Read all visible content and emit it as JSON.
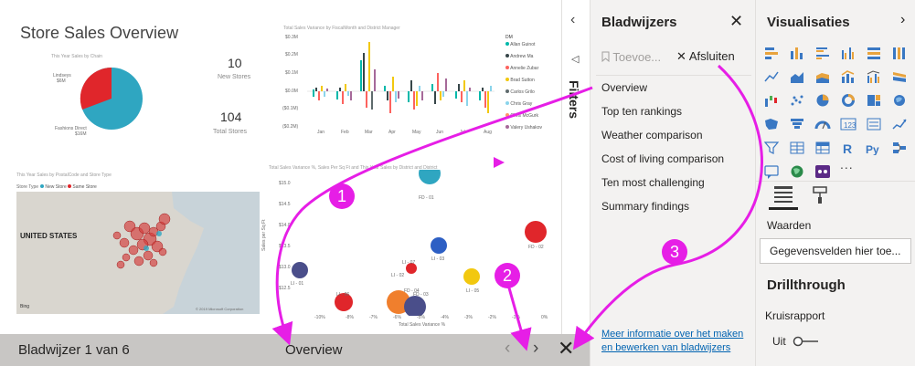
{
  "report": {
    "title": "Store Sales Overview",
    "pie": {
      "title": "This Year Sales by Chain",
      "slices": [
        {
          "label": "Lindseys",
          "value_label": "$6M",
          "share": 0.3,
          "color": "#e0262b"
        },
        {
          "label": "Fashions Direct",
          "value_label": "$16M",
          "share": 0.7,
          "color": "#2fa6c1"
        }
      ]
    },
    "kpis": [
      {
        "value": "10",
        "label": "New Stores"
      },
      {
        "value": "104",
        "label": "Total Stores"
      }
    ],
    "variance_chart": {
      "title": "Total Sales Variance by FiscalMonth and District Manager",
      "y_ticks": [
        "$0.3M",
        "$0.2M",
        "$0.1M",
        "$0.0M",
        "($0.1M)",
        "($0.2M)"
      ],
      "x_ticks": [
        "Jan",
        "Feb",
        "Mar",
        "Apr",
        "May",
        "Jun",
        "Jul",
        "Aug"
      ],
      "legend_title": "DM",
      "legend": [
        {
          "name": "Allan Guinot",
          "color": "#01b8aa"
        },
        {
          "name": "Andrew Ma",
          "color": "#374649"
        },
        {
          "name": "Annelie Zubar",
          "color": "#fd625e"
        },
        {
          "name": "Brad Sutton",
          "color": "#f2c80f"
        },
        {
          "name": "Carlos Grilo",
          "color": "#5f6b6d"
        },
        {
          "name": "Chris Gray",
          "color": "#8ad4eb"
        },
        {
          "name": "Chris McGurk",
          "color": "#fe9666"
        },
        {
          "name": "Valery Ushakov",
          "color": "#a66999"
        }
      ]
    },
    "map": {
      "title": "This Year Sales by PostalCode and Store Type",
      "legend_title": "Store Type",
      "legend": [
        {
          "name": "New Store",
          "color": "#2fa6c1"
        },
        {
          "name": "Same Store",
          "color": "#e0262b"
        }
      ],
      "country_label": "UNITED STATES",
      "provider": "Bing",
      "copyright": "© 2019 Microsoft Corporation"
    },
    "scatter": {
      "title": "Total Sales Variance %, Sales Per Sq Ft and This Year Sales by District and District",
      "x_label": "Total Sales Variance %",
      "y_label": "Sales per Sq Ft",
      "y_ticks": [
        "$15.0",
        "$14.5",
        "$14.0",
        "$13.5",
        "$13.0",
        "$12.5"
      ],
      "x_ticks": [
        "-10%",
        "-8%",
        "-7%",
        "-6%",
        "-5%",
        "-4%",
        "-3%",
        "-2%",
        "-1%",
        "0%"
      ],
      "point_labels": [
        "FD - 01",
        "FD - 02",
        "LI - 03",
        "LI - 01",
        "LI - 07",
        "LI - 02",
        "LI - 05",
        "LI - 06",
        "FD - 04",
        "FD - 03"
      ]
    }
  },
  "bookmark_bar": {
    "count_text": "Bladwijzer 1 van 6",
    "current_name": "Overview",
    "prev_icon": "chevron-left-icon",
    "next_icon": "chevron-right-icon",
    "close_icon": "close-icon"
  },
  "filters": {
    "label": "Filters"
  },
  "bookmarks_pane": {
    "title": "Bladwijzers",
    "add_label": "Toevoe...",
    "exit_label": "Afsluiten",
    "items": [
      "Overview",
      "Top ten rankings",
      "Weather comparison",
      "Cost of living comparison",
      "Ten most challenging",
      "Summary findings"
    ],
    "help_link": "Meer informatie over het maken en bewerken van bladwijzers"
  },
  "visualizations_pane": {
    "title": "Visualisaties",
    "more": "...",
    "values_label": "Waarden",
    "field_placeholder": "Gegevensvelden hier toe...",
    "drillthrough_title": "Drillthrough",
    "cross_report_label": "Kruisrapport",
    "toggle_label": "Uit"
  },
  "annotations": [
    {
      "number": "1",
      "color": "#e61ee6"
    },
    {
      "number": "2",
      "color": "#e61ee6"
    },
    {
      "number": "3",
      "color": "#e61ee6"
    }
  ]
}
